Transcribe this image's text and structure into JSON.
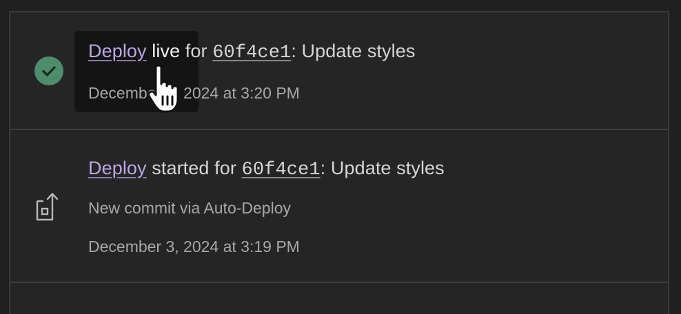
{
  "events": [
    {
      "status_icon": "check-circle-icon",
      "link_label": "Deploy",
      "status_word": "live",
      "for_label": "for",
      "commit_hash": "60f4ce1",
      "commit_message": ": Update styles",
      "timestamp": "December 3, 2024 at 3:20 PM"
    },
    {
      "status_icon": "deploy-commit-icon",
      "link_label": "Deploy",
      "status_word": "started",
      "for_label": "for",
      "commit_hash": "60f4ce1",
      "commit_message": ": Update styles",
      "description": "New commit via Auto-Deploy",
      "timestamp": "December 3, 2024 at 3:19 PM"
    }
  ],
  "colors": {
    "success": "#4e8d6c",
    "link": "#bda7e6",
    "background": "#252525"
  },
  "cursor": "hand-pointer-icon"
}
